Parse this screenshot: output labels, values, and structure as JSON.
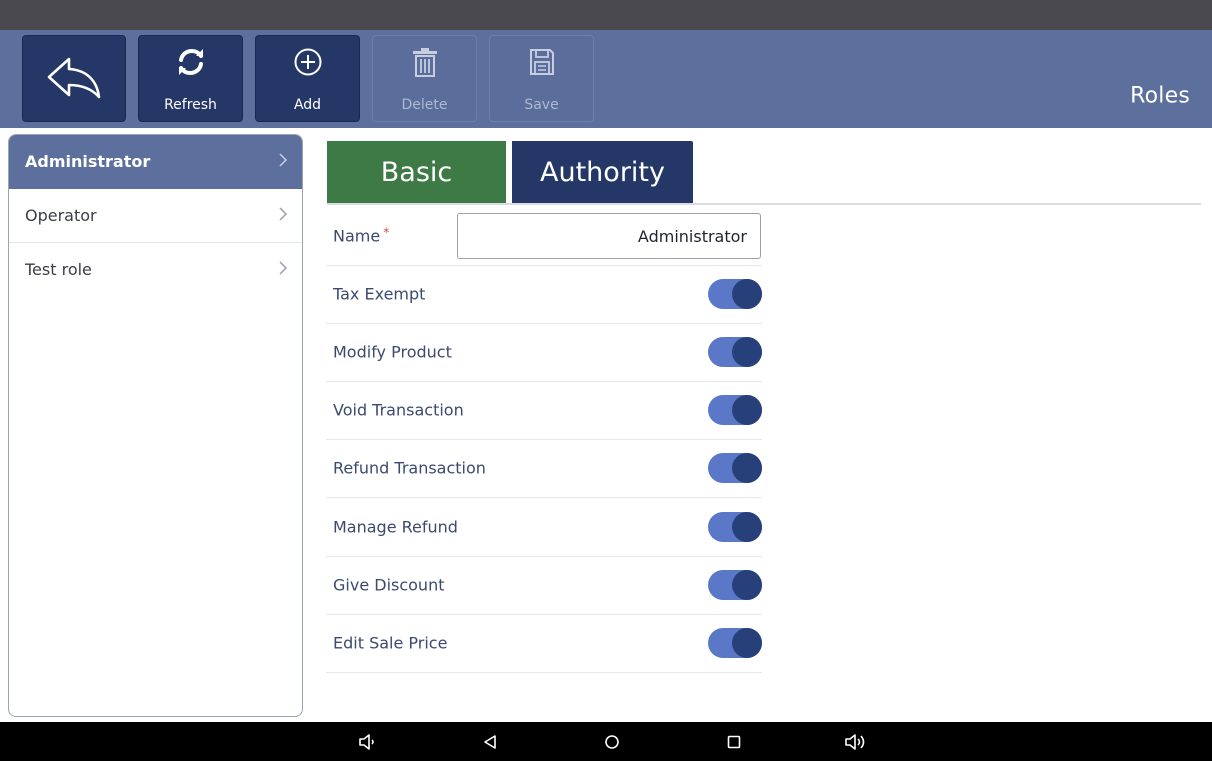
{
  "toolbar": {
    "back": {
      "icon": "back-arrow-icon"
    },
    "refresh": {
      "label": "Refresh",
      "icon": "refresh-icon"
    },
    "add": {
      "label": "Add",
      "icon": "plus-circle-icon"
    },
    "delete": {
      "label": "Delete",
      "icon": "trash-icon",
      "enabled": false
    },
    "save": {
      "label": "Save",
      "icon": "floppy-disk-icon",
      "enabled": false
    },
    "title": "Roles"
  },
  "sidebar": {
    "items": [
      {
        "label": "Administrator",
        "selected": true
      },
      {
        "label": "Operator",
        "selected": false
      },
      {
        "label": "Test role",
        "selected": false
      }
    ]
  },
  "tabs": [
    {
      "label": "Basic",
      "color": "#3e7a45"
    },
    {
      "label": "Authority",
      "color": "#243766"
    }
  ],
  "form": {
    "name_label": "Name",
    "name_required_mark": "*",
    "name_value": "Administrator",
    "toggles": [
      {
        "label": "Tax Exempt",
        "on": true
      },
      {
        "label": "Modify Product",
        "on": true
      },
      {
        "label": "Void Transaction",
        "on": true
      },
      {
        "label": "Refund Transaction",
        "on": true
      },
      {
        "label": "Manage Refund",
        "on": true
      },
      {
        "label": "Give Discount",
        "on": true
      },
      {
        "label": "Edit Sale Price",
        "on": true
      }
    ]
  },
  "colors": {
    "toolbar_bg": "#5d6f9c",
    "button_bg": "#243766",
    "toggle_track": "#5b78c8",
    "toggle_knob": "#27407a"
  },
  "navbar": {
    "icons": [
      "volume-down-icon",
      "nav-back-icon",
      "nav-home-icon",
      "nav-recents-icon",
      "volume-up-icon"
    ]
  }
}
